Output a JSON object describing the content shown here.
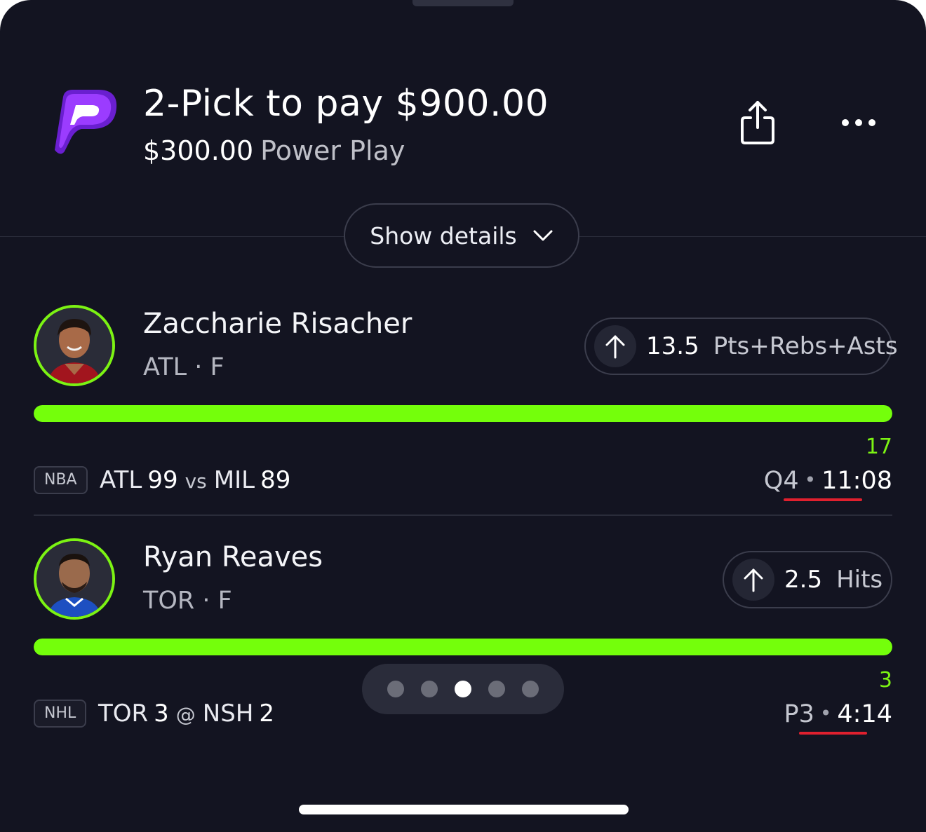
{
  "header": {
    "title": "2-Pick to pay $900.00",
    "entry_amount": "$300.00",
    "play_type": "Power Play",
    "share_icon": "share-icon",
    "more_icon": "more-icon",
    "logo_icon": "prizepicks-logo-icon"
  },
  "details_button": {
    "label": "Show details",
    "icon": "chevron-down-icon"
  },
  "picks": [
    {
      "player_name": "Zaccharie Risacher",
      "team_position": "ATL · F",
      "direction_icon": "arrow-up-icon",
      "line": "13.5",
      "stat": "Pts+Rebs+Asts",
      "progress": 1.0,
      "current_value": "17",
      "league": "NBA",
      "home_team": "ATL",
      "home_score": "99",
      "separator": "vs",
      "away_team": "MIL",
      "away_score": "89",
      "period": "Q4",
      "clock_dot": "•",
      "time": "11:08"
    },
    {
      "player_name": "Ryan Reaves",
      "team_position": "TOR · F",
      "direction_icon": "arrow-up-icon",
      "line": "2.5",
      "stat": "Hits",
      "progress": 1.0,
      "current_value": "3",
      "league": "NHL",
      "home_team": "TOR",
      "home_score": "3",
      "separator": "@",
      "away_team": "NSH",
      "away_score": "2",
      "period": "P3",
      "clock_dot": "•",
      "time": "4:14"
    }
  ],
  "pager": {
    "count": 5,
    "active_index": 2
  },
  "colors": {
    "background": "#131421",
    "accent_green": "#74ff0b",
    "logo_purple": "#8a2bf0",
    "live_red": "#e0202e"
  }
}
